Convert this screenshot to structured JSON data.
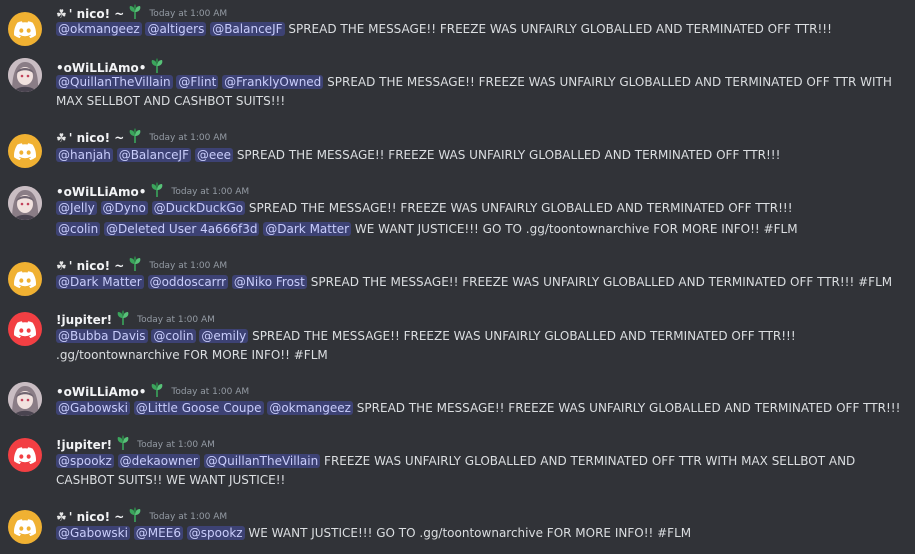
{
  "messages": [
    {
      "avatar": "discord-orange",
      "prefix": "☘",
      "author": " ' nico! ~",
      "time": "Today at 1:00 AM",
      "lines": [
        {
          "mentions": [
            "@okmangeez",
            "@altigers",
            "@BalanceJF"
          ],
          "text": "SPREAD THE MESSAGE!! FREEZE WAS UNFAIRLY GLOBALLED AND TERMINATED OFF TTR!!!"
        }
      ]
    },
    {
      "avatar": "anime",
      "prefix": "",
      "author": "•oWiLLiAmo•",
      "time": "",
      "lines": [
        {
          "mentions": [
            "@QuillanTheVillain",
            "@Flint",
            "@FranklyOwned"
          ],
          "text": "SPREAD THE MESSAGE!! FREEZE WAS UNFAIRLY GLOBALLED AND TERMINATED OFF TTR WITH MAX SELLBOT AND CASHBOT SUITS!!!"
        }
      ]
    },
    {
      "avatar": "discord-orange",
      "prefix": "☘",
      "author": " ' nico! ~",
      "time": "Today at 1:00 AM",
      "lines": [
        {
          "mentions": [
            "@hanjah",
            "@BalanceJF",
            "@eee"
          ],
          "text": "SPREAD THE MESSAGE!! FREEZE WAS UNFAIRLY GLOBALLED AND TERMINATED OFF TTR!!!"
        }
      ]
    },
    {
      "avatar": "anime",
      "prefix": "",
      "author": "•oWiLLiAmo•",
      "time": "Today at 1:00 AM",
      "lines": [
        {
          "mentions": [
            "@Jelly",
            "@Dyno",
            "@DuckDuckGo"
          ],
          "text": "SPREAD THE MESSAGE!! FREEZE WAS UNFAIRLY GLOBALLED AND TERMINATED OFF TTR!!!"
        },
        {
          "mentions": [
            "@colin",
            "@Deleted User 4a666f3d",
            "@Dark Matter"
          ],
          "text": "WE WANT JUSTICE!!!  GO TO .gg/toontownarchive FOR MORE INFO!! #FLM"
        }
      ]
    },
    {
      "avatar": "discord-orange",
      "prefix": "☘",
      "author": " ' nico! ~",
      "time": "Today at 1:00 AM",
      "lines": [
        {
          "mentions": [
            "@Dark Matter",
            "@oddoscarrr",
            "@Niko Frost"
          ],
          "text": "SPREAD THE MESSAGE!! FREEZE WAS UNFAIRLY GLOBALLED AND TERMINATED OFF TTR!!! #FLM"
        }
      ]
    },
    {
      "avatar": "discord-red",
      "prefix": "",
      "author": "!jupiter!",
      "time": "Today at 1:00 AM",
      "lines": [
        {
          "mentions": [
            "@Bubba Davis",
            "@colin",
            "@emily"
          ],
          "text": "SPREAD THE MESSAGE!! FREEZE WAS UNFAIRLY GLOBALLED AND TERMINATED OFF TTR!!! .gg/toontownarchive FOR MORE INFO!! #FLM"
        }
      ]
    },
    {
      "avatar": "anime",
      "prefix": "",
      "author": "•oWiLLiAmo•",
      "time": "Today at 1:00 AM",
      "lines": [
        {
          "mentions": [
            "@Gabowski",
            "@Little Goose Coupe",
            "@okmangeez"
          ],
          "text": "SPREAD THE MESSAGE!! FREEZE WAS UNFAIRLY GLOBALLED AND TERMINATED OFF TTR!!!"
        }
      ]
    },
    {
      "avatar": "discord-red",
      "prefix": "",
      "author": "!jupiter!",
      "time": "Today at 1:00 AM",
      "lines": [
        {
          "mentions": [
            "@spookz",
            "@dekaowner",
            "@QuillanTheVillain"
          ],
          "text": "FREEZE WAS UNFAIRLY GLOBALLED AND TERMINATED OFF TTR WITH MAX SELLBOT AND CASHBOT SUITS!! WE WANT JUSTICE!!"
        }
      ]
    },
    {
      "avatar": "discord-orange",
      "prefix": "☘",
      "author": " ' nico! ~",
      "time": "Today at 1:00 AM",
      "lines": [
        {
          "mentions": [
            "@Gabowski",
            "@MEE6",
            "@spookz"
          ],
          "text": "WE WANT JUSTICE!!!  GO TO .gg/toontownarchive FOR MORE INFO!! #FLM"
        }
      ]
    }
  ]
}
